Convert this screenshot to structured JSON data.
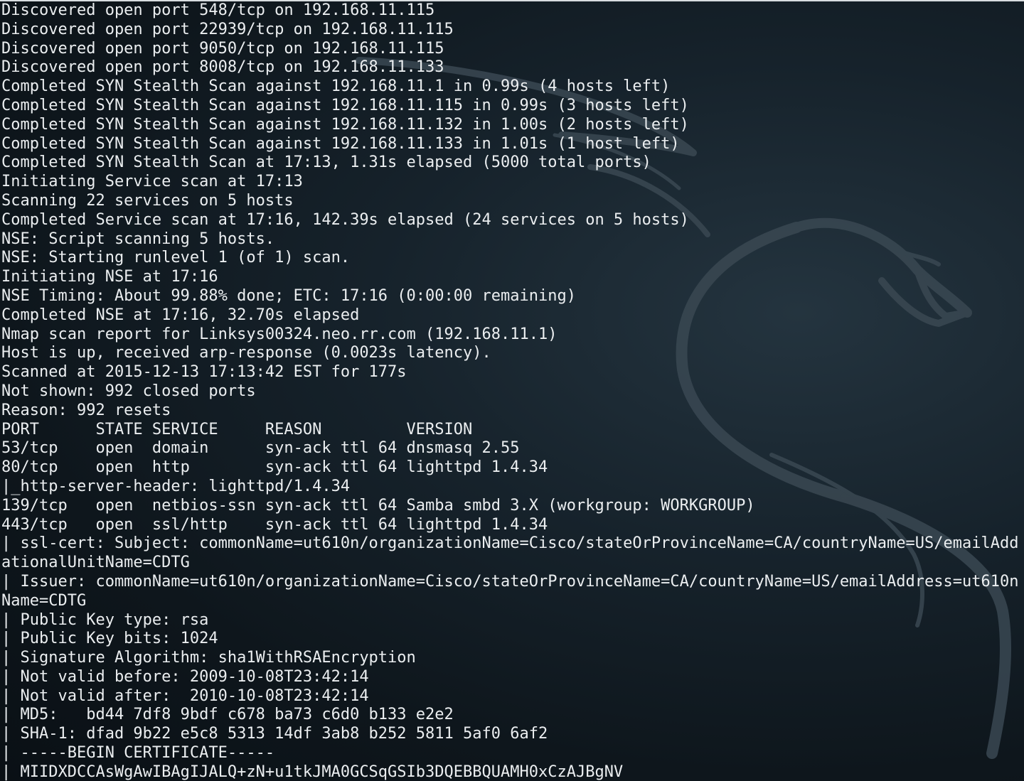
{
  "terminal": {
    "lines": [
      "Discovered open port 548/tcp on 192.168.11.115",
      "Discovered open port 22939/tcp on 192.168.11.115",
      "Discovered open port 9050/tcp on 192.168.11.115",
      "Discovered open port 8008/tcp on 192.168.11.133",
      "Completed SYN Stealth Scan against 192.168.11.1 in 0.99s (4 hosts left)",
      "Completed SYN Stealth Scan against 192.168.11.115 in 0.99s (3 hosts left)",
      "Completed SYN Stealth Scan against 192.168.11.132 in 1.00s (2 hosts left)",
      "Completed SYN Stealth Scan against 192.168.11.133 in 1.01s (1 host left)",
      "Completed SYN Stealth Scan at 17:13, 1.31s elapsed (5000 total ports)",
      "Initiating Service scan at 17:13",
      "Scanning 22 services on 5 hosts",
      "Completed Service scan at 17:16, 142.39s elapsed (24 services on 5 hosts)",
      "NSE: Script scanning 5 hosts.",
      "NSE: Starting runlevel 1 (of 1) scan.",
      "Initiating NSE at 17:16",
      "NSE Timing: About 99.88% done; ETC: 17:16 (0:00:00 remaining)",
      "Completed NSE at 17:16, 32.70s elapsed",
      "Nmap scan report for Linksys00324.neo.rr.com (192.168.11.1)",
      "Host is up, received arp-response (0.0023s latency).",
      "Scanned at 2015-12-13 17:13:42 EST for 177s",
      "Not shown: 992 closed ports",
      "Reason: 992 resets",
      "PORT      STATE SERVICE     REASON         VERSION",
      "53/tcp    open  domain      syn-ack ttl 64 dnsmasq 2.55",
      "80/tcp    open  http        syn-ack ttl 64 lighttpd 1.4.34",
      "|_http-server-header: lighttpd/1.4.34",
      "139/tcp   open  netbios-ssn syn-ack ttl 64 Samba smbd 3.X (workgroup: WORKGROUP)",
      "443/tcp   open  ssl/http    syn-ack ttl 64 lighttpd 1.4.34",
      "| ssl-cert: Subject: commonName=ut610n/organizationName=Cisco/stateOrProvinceName=CA/countryName=US/emailAdd",
      "ationalUnitName=CDTG",
      "| Issuer: commonName=ut610n/organizationName=Cisco/stateOrProvinceName=CA/countryName=US/emailAddress=ut610n",
      "Name=CDTG",
      "| Public Key type: rsa",
      "| Public Key bits: 1024",
      "| Signature Algorithm: sha1WithRSAEncryption",
      "| Not valid before: 2009-10-08T23:42:14",
      "| Not valid after:  2010-10-08T23:42:14",
      "| MD5:   bd44 7df8 9bdf c678 ba73 c6d0 b133 e2e2",
      "| SHA-1: dfad 9b22 e5c8 5313 14df 3ab8 b252 5811 5af0 6af2",
      "| -----BEGIN CERTIFICATE-----",
      "| MIIDXDCCAsWgAwIBAgIJALQ+zN+u1tkJMA0GCSqGSIb3DQEBBQUAMH0xCzAJBgNV"
    ]
  },
  "background": {
    "logo_icon": "kali-dragon-icon",
    "colors": {
      "bg_dark": "#0e161c",
      "bg_light": "#24343f",
      "text": "#ebeef0"
    }
  }
}
